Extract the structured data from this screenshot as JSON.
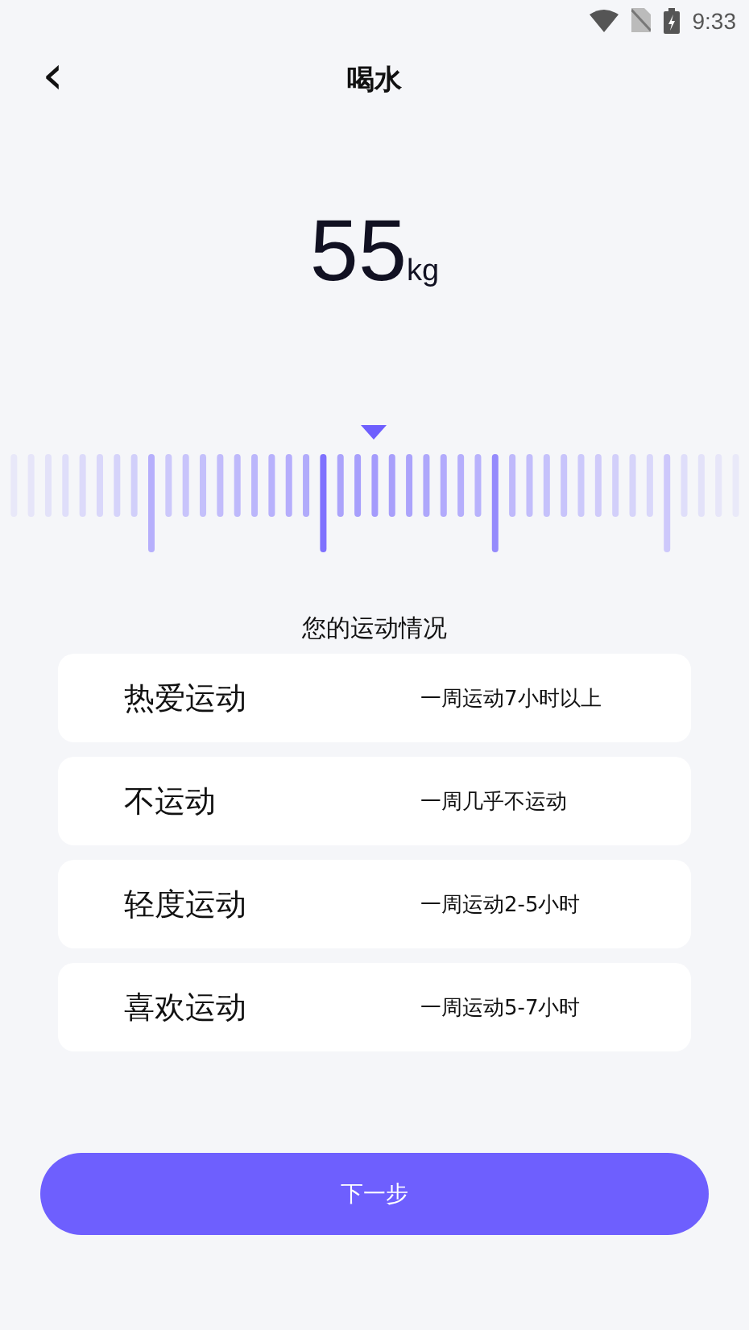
{
  "status_bar": {
    "time": "9:33"
  },
  "header": {
    "back": "‹",
    "title": "喝水"
  },
  "reading": {
    "value": "55",
    "unit": "kg"
  },
  "section_title": "您的运动情况",
  "options": [
    {
      "label": "热爱运动",
      "description": "一周运动7小时以上"
    },
    {
      "label": "不运动",
      "description": "一周几乎不运动"
    },
    {
      "label": "轻度运动",
      "description": "一周运动2-5小时"
    },
    {
      "label": "喜欢运动",
      "description": "一周运动5-7小时"
    }
  ],
  "next_button": "下一步"
}
